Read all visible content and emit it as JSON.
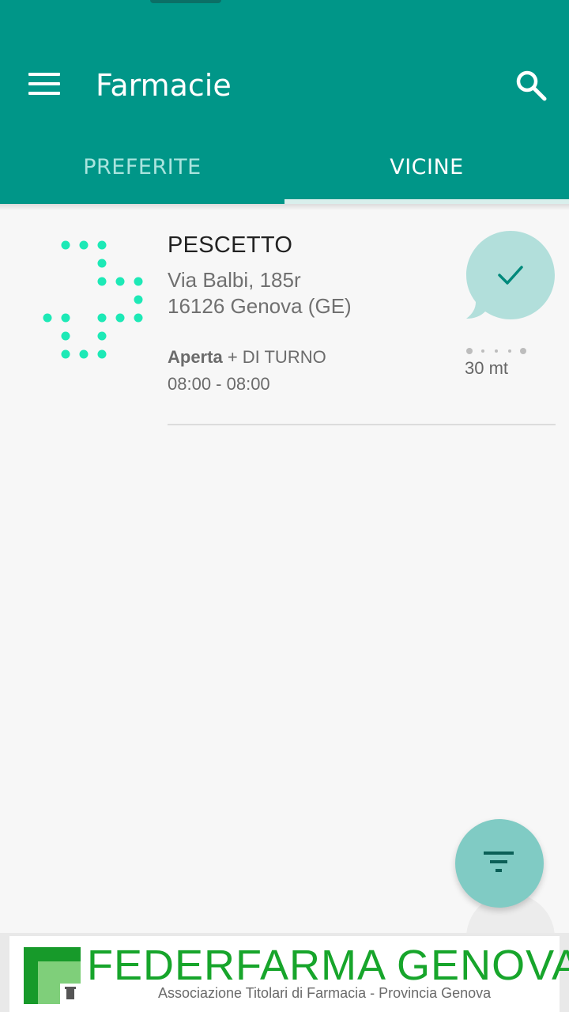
{
  "app": {
    "title": "Farmacie"
  },
  "tabs": [
    {
      "label": "PREFERITE",
      "selected": false
    },
    {
      "label": "VICINE",
      "selected": true
    }
  ],
  "pharmacies": [
    {
      "name": "PESCETTO",
      "address_line1": "Via Balbi, 185r",
      "address_line2": "16126 Genova (GE)",
      "status_open": "Aperta",
      "status_extra": "+ DI TURNO",
      "hours": "08:00 - 08:00",
      "distance": "30 mt",
      "badge_icon": "check-icon"
    }
  ],
  "fab": {
    "icon": "filter-icon"
  },
  "banner": {
    "title": "FEDERFARMA GENOVA",
    "subtitle": "Associazione Titolari di Farmacia - Provincia Genova"
  },
  "colors": {
    "primary": "#009688",
    "accent_cross": "#1de9b6",
    "bubble": "#b2dfdb",
    "fab": "#80cbc4",
    "banner_green": "#17a52b"
  }
}
